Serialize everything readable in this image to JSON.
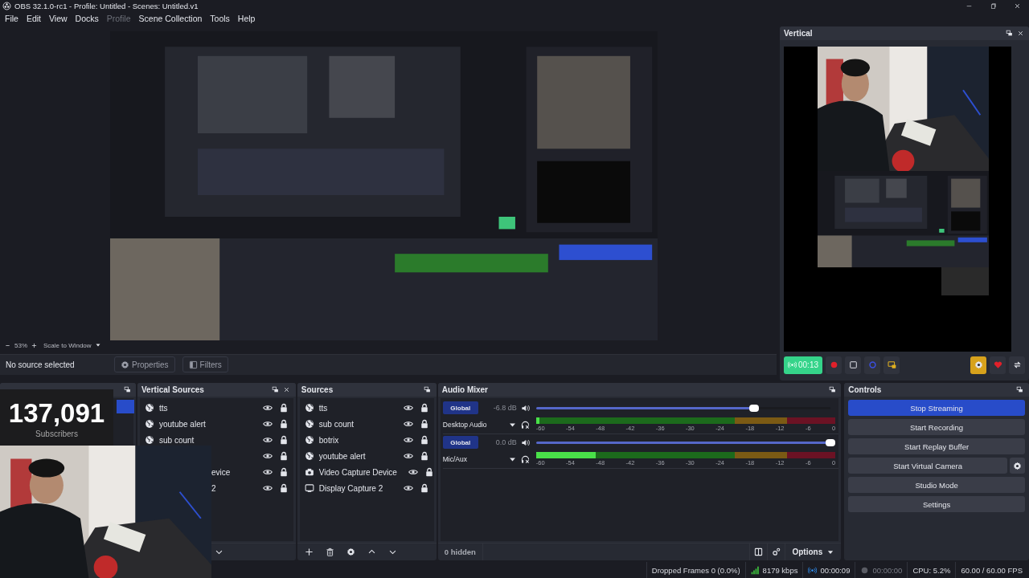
{
  "window": {
    "title": "OBS 32.1.0-rc1 - Profile: Untitled - Scenes: Untitled.v1"
  },
  "menu": [
    {
      "label": "File",
      "disabled": false
    },
    {
      "label": "Edit",
      "disabled": false
    },
    {
      "label": "View",
      "disabled": false
    },
    {
      "label": "Docks",
      "disabled": false
    },
    {
      "label": "Profile",
      "disabled": true
    },
    {
      "label": "Scene Collection",
      "disabled": false
    },
    {
      "label": "Tools",
      "disabled": false
    },
    {
      "label": "Help",
      "disabled": false
    }
  ],
  "preview": {
    "kind": "picture",
    "zoom": "53%",
    "scale_mode": "Scale to Window"
  },
  "source_toolbar": {
    "status": "No source selected",
    "properties": "Properties",
    "filters": "Filters"
  },
  "vertical_dock": {
    "title": "Vertical",
    "streaming": true,
    "stream_time": "00:13"
  },
  "scenes_dock": {
    "selected_row": true
  },
  "vertical_sources": {
    "title": "Vertical Sources",
    "items": [
      {
        "kind": "browser",
        "name": "tts",
        "visible": true,
        "locked": true
      },
      {
        "kind": "browser",
        "name": "youtube alert",
        "visible": true,
        "locked": true
      },
      {
        "kind": "browser",
        "name": "sub count",
        "visible": true,
        "locked": true
      },
      {
        "kind": "partial",
        "visible": true,
        "locked": true
      },
      {
        "kind": "partial",
        "name": "evice",
        "visible": true,
        "locked": true
      },
      {
        "kind": "partial",
        "name": "2",
        "visible": true,
        "locked": true
      }
    ]
  },
  "sources": {
    "title": "Sources",
    "items": [
      {
        "kind": "browser",
        "name": "tts",
        "visible": true,
        "locked": true
      },
      {
        "kind": "browser",
        "name": "sub count",
        "visible": true,
        "locked": true
      },
      {
        "kind": "browser",
        "name": "botrix",
        "visible": true,
        "locked": true
      },
      {
        "kind": "browser",
        "name": "youtube alert",
        "visible": true,
        "locked": true
      },
      {
        "kind": "camera",
        "name": "Video Capture Device",
        "visible": true,
        "locked": true
      },
      {
        "kind": "display",
        "name": "Display Capture 2",
        "visible": true,
        "locked": true
      }
    ]
  },
  "audio_mixer": {
    "title": "Audio Mixer",
    "hidden_count": "0 hidden",
    "options": "Options",
    "channels": [
      {
        "name": "Desktop Audio",
        "mode": "Global",
        "reading": "-6.8 dB",
        "volume": {
          "level": 0.74
        },
        "meter": {
          "level": 0.01,
          "scale": [
            "-60",
            "-54",
            "-48",
            "-42",
            "-36",
            "-30",
            "-24",
            "-18",
            "-12",
            "-6",
            "0"
          ]
        }
      },
      {
        "name": "Mic/Aux",
        "mode": "Global",
        "reading": "0.0 dB",
        "volume": {
          "level": 1
        },
        "meter": {
          "level": 0.2,
          "scale": [
            "-60",
            "-54",
            "-48",
            "-42",
            "-36",
            "-30",
            "-24",
            "-18",
            "-12",
            "-6",
            "0"
          ]
        }
      }
    ]
  },
  "controls": {
    "title": "Controls",
    "buttons": [
      {
        "kind": "plain",
        "label": "Stop Streaming",
        "active": true
      },
      {
        "kind": "plain",
        "label": "Start Recording",
        "active": false
      },
      {
        "kind": "plain",
        "label": "Start Replay Buffer",
        "active": false
      },
      {
        "kind": "with_settings",
        "label": "Start Virtual Camera",
        "active": false
      },
      {
        "kind": "plain",
        "label": "Studio Mode",
        "active": false
      },
      {
        "kind": "plain",
        "label": "Settings",
        "active": false
      }
    ]
  },
  "overlay": {
    "count": "137,091",
    "caption": "Subscribers"
  },
  "status_bar": {
    "dropped_frames": "Dropped Frames 0 (0.0%)",
    "bitrate": "8179 kbps",
    "stream_time": "00:00:09",
    "recording": false,
    "record_time": "00:00:00",
    "cpu": "CPU: 5.2%",
    "fps": "60.00 / 60.00 FPS"
  }
}
